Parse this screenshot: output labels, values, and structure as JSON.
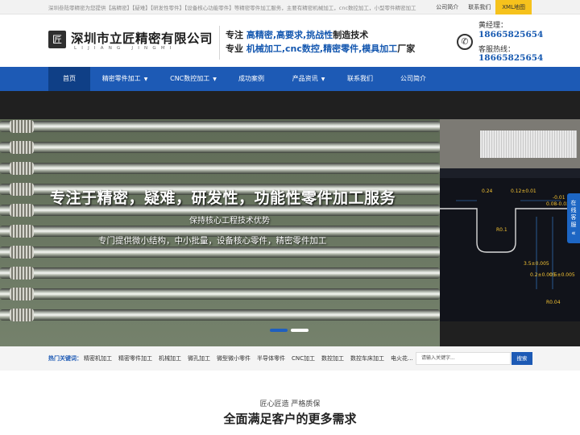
{
  "topbar": {
    "intro": "深圳叁陆零精密为您提供【高精密】【疑难】【研发性零件】【设备核心功能零件】等精密零件加工服务，主要有精密机械加工，cnc数控加工，小型零件精密加工",
    "links": [
      "公司简介",
      "联系我们",
      "XML地图"
    ]
  },
  "header": {
    "logo_char": "匠",
    "company": "深圳市立匠精密有限公司",
    "company_en": "LIJIANG JINGMI",
    "slogan1_pre": "专注 ",
    "slogan1_hl": "高精密,高要求,挑战性",
    "slogan1_post": "制造技术",
    "slogan2_pre": "专业 ",
    "slogan2_hl": "机械加工,cnc数控,精密零件,模具加工",
    "slogan2_post": "厂家",
    "contact_label1": "黄经理：",
    "contact_num1": "18665825654",
    "contact_label2": "客服热线：",
    "contact_num2": "18665825654",
    "phone_icon": "phone-icon"
  },
  "nav": {
    "items": [
      "首页",
      "精密零件加工",
      "CNC数控加工",
      "成功案例",
      "产品资讯",
      "联系我们",
      "公司简介"
    ],
    "caret": "▼"
  },
  "banner": {
    "title": "专注于精密，疑难，研发性，功能性零件加工服务",
    "sub1": "保持核心工程技术优势",
    "sub2": "专门提供微小结构，中小批量，设备核心零件，精密零件加工",
    "float_tab": "在线客服",
    "float_arrow": "«",
    "cad_labels": [
      "0.24",
      "0.12±0.01",
      "-0.01",
      "0.08-0.02",
      "R0.1",
      "R0.04",
      "3.5±0.005",
      "0.2±0.005",
      "0.5±0.005"
    ]
  },
  "keywords": {
    "label": "热门关键词：",
    "items": [
      "精密机加工",
      "精密零件加工",
      "机械加工",
      "微孔加工",
      "微型微小零件",
      "半导体零件",
      "CNC加工",
      "数控加工",
      "数控车床加工",
      "电火花..."
    ],
    "search_placeholder": "请输入关键字...",
    "search_button": "搜索"
  },
  "section": {
    "subtitle": "匠心匠造 严格质保",
    "title": "全面满足客户的更多需求"
  },
  "colors": {
    "brand_blue": "#1d5ab5",
    "nav_active": "#0f3f86",
    "xml_yellow": "#f6c21c"
  }
}
